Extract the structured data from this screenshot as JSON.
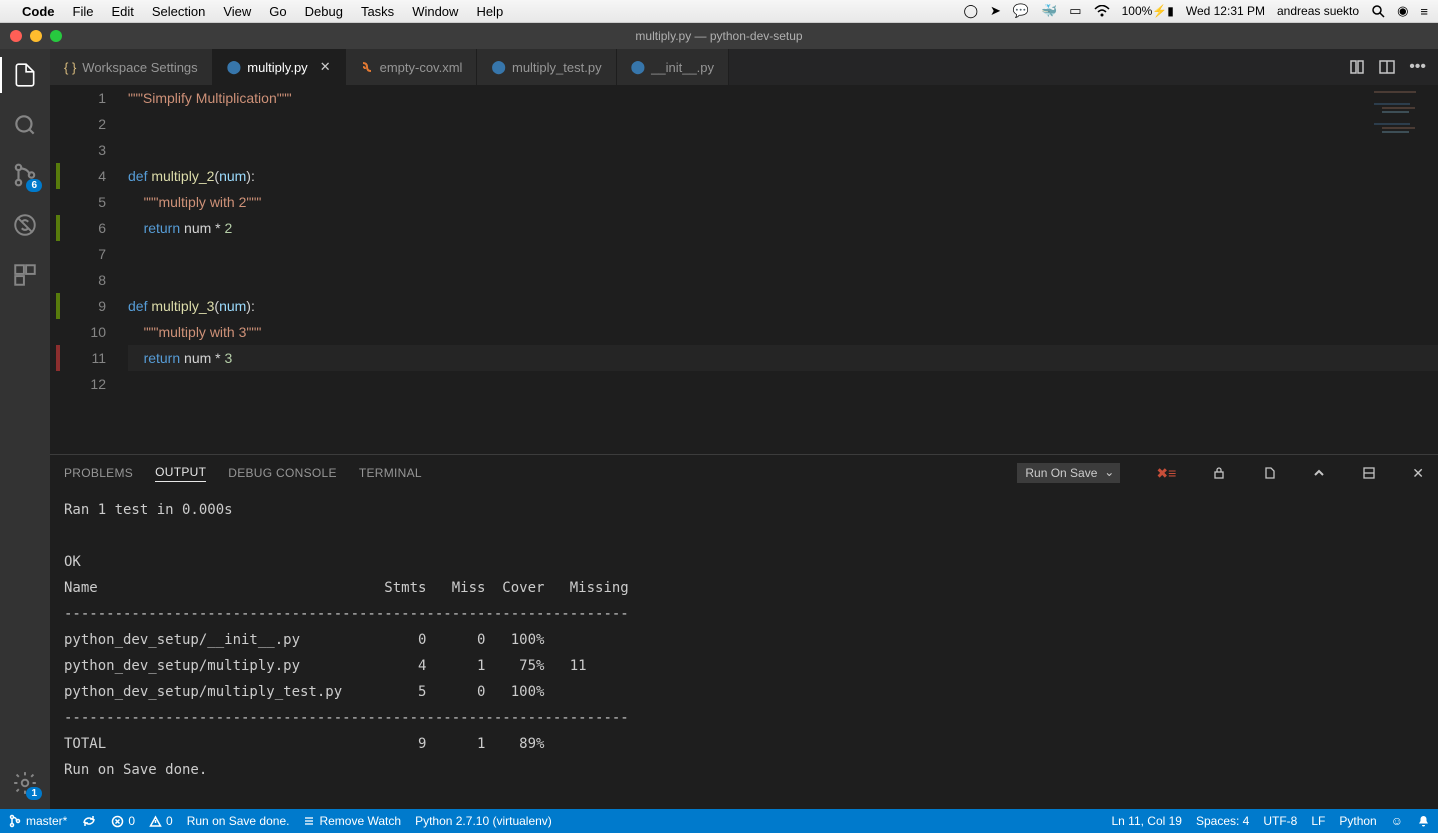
{
  "menubar": {
    "app": "Code",
    "items": [
      "File",
      "Edit",
      "Selection",
      "View",
      "Go",
      "Debug",
      "Tasks",
      "Window",
      "Help"
    ],
    "battery": "100%",
    "clock": "Wed 12:31 PM",
    "user": "andreas suekto"
  },
  "titlebar": {
    "title": "multiply.py — python-dev-setup"
  },
  "activitybar": {
    "scm_badge": "6",
    "settings_badge": "1"
  },
  "tabs": [
    {
      "label": "Workspace Settings",
      "icon": "braces",
      "active": false,
      "close": false
    },
    {
      "label": "multiply.py",
      "icon": "python",
      "active": true,
      "close": true
    },
    {
      "label": "empty-cov.xml",
      "icon": "xml",
      "active": false,
      "close": false
    },
    {
      "label": "multiply_test.py",
      "icon": "python",
      "active": false,
      "close": false
    },
    {
      "label": "__init__.py",
      "icon": "python",
      "active": false,
      "close": false
    }
  ],
  "editor": {
    "lines": [
      {
        "n": 1,
        "html": "<span class='str'>\"\"\"Simplify Multiplication\"\"\"</span>"
      },
      {
        "n": 2,
        "html": ""
      },
      {
        "n": 3,
        "html": ""
      },
      {
        "n": 4,
        "html": "<span class='kw'>def</span> <span class='fn'>multiply_2</span>(<span class='param'>num</span>):",
        "git": "add"
      },
      {
        "n": 5,
        "html": "    <span class='str'>\"\"\"multiply with 2\"\"\"</span>"
      },
      {
        "n": 6,
        "html": "    <span class='kw'>return</span> num <span class='op'>*</span> <span class='num'>2</span>",
        "git": "add"
      },
      {
        "n": 7,
        "html": ""
      },
      {
        "n": 8,
        "html": ""
      },
      {
        "n": 9,
        "html": "<span class='kw'>def</span> <span class='fn'>multiply_3</span>(<span class='param'>num</span>):",
        "git": "add"
      },
      {
        "n": 10,
        "html": "    <span class='str'>\"\"\"multiply with 3\"\"\"</span>"
      },
      {
        "n": 11,
        "html": "    <span class='kw'>return</span> num <span class='op'>*</span> <span class='num'>3</span>",
        "git": "mod",
        "current": true
      },
      {
        "n": 12,
        "html": ""
      }
    ]
  },
  "panel": {
    "tabs": [
      "PROBLEMS",
      "OUTPUT",
      "DEBUG CONSOLE",
      "TERMINAL"
    ],
    "active": "OUTPUT",
    "channel": "Run On Save",
    "output": "Ran 1 test in 0.000s\n\nOK\nName                                  Stmts   Miss  Cover   Missing\n-------------------------------------------------------------------\npython_dev_setup/__init__.py              0      0   100%\npython_dev_setup/multiply.py              4      1    75%   11\npython_dev_setup/multiply_test.py         5      0   100%\n-------------------------------------------------------------------\nTOTAL                                     9      1    89%\nRun on Save done."
  },
  "statusbar": {
    "branch": "master*",
    "errors": "0",
    "warnings": "0",
    "run_save": "Run on Save done.",
    "remove_watch": "Remove Watch",
    "python": "Python 2.7.10 (virtualenv)",
    "cursor": "Ln 11, Col 19",
    "spaces": "Spaces: 4",
    "encoding": "UTF-8",
    "eol": "LF",
    "lang": "Python"
  }
}
